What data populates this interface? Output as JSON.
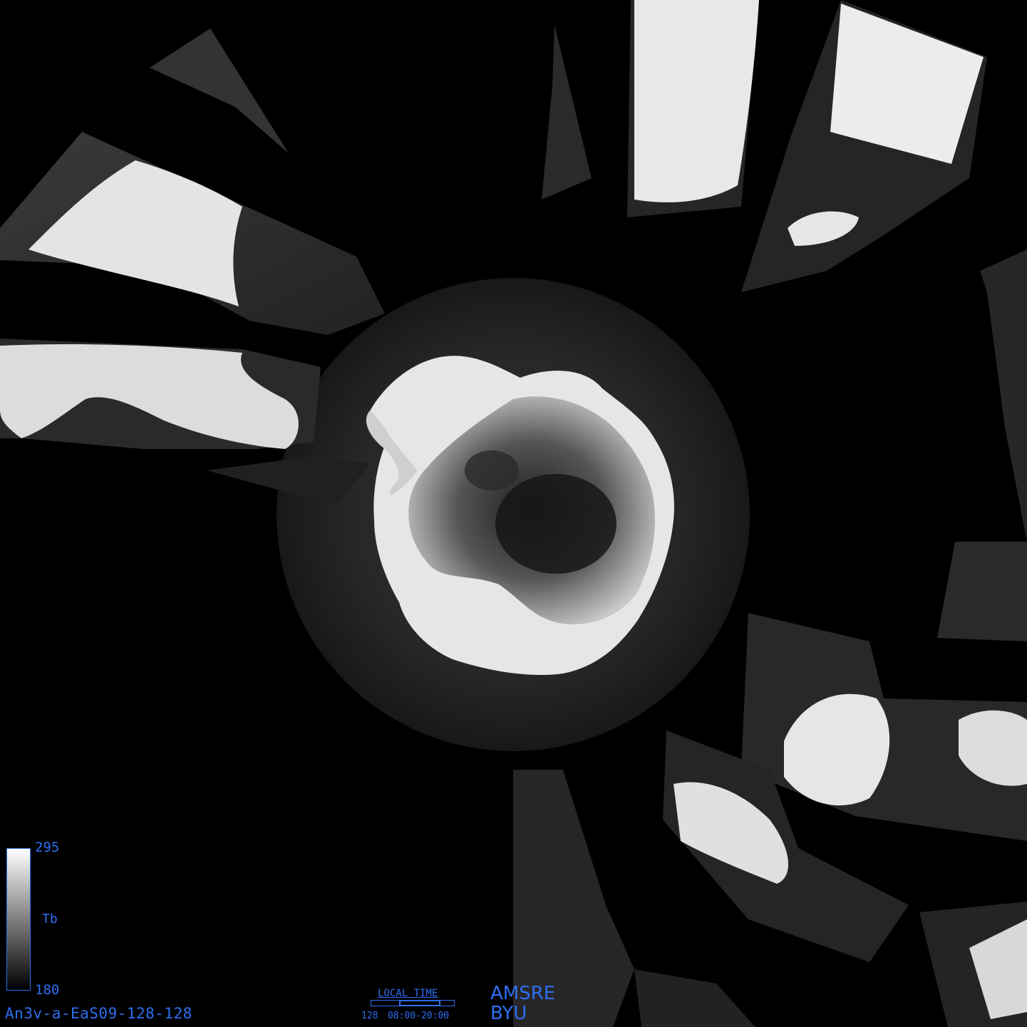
{
  "image": {
    "product_id": "An3v-a-EaS09-128-128",
    "sensor": "AMSRE",
    "organization": "BYU"
  },
  "colorbar": {
    "max_label": "295",
    "min_label": "180",
    "variable_label": "Tb",
    "gradient_top": "#ffffff",
    "gradient_bottom": "#000000"
  },
  "local_time": {
    "title": "LOCAL TIME",
    "day": "128",
    "range": "08:00-20:00",
    "window_start_fraction": 0.333,
    "window_end_fraction": 0.833
  },
  "colors": {
    "annotation": "#2f6ff0",
    "background": "#000000"
  }
}
